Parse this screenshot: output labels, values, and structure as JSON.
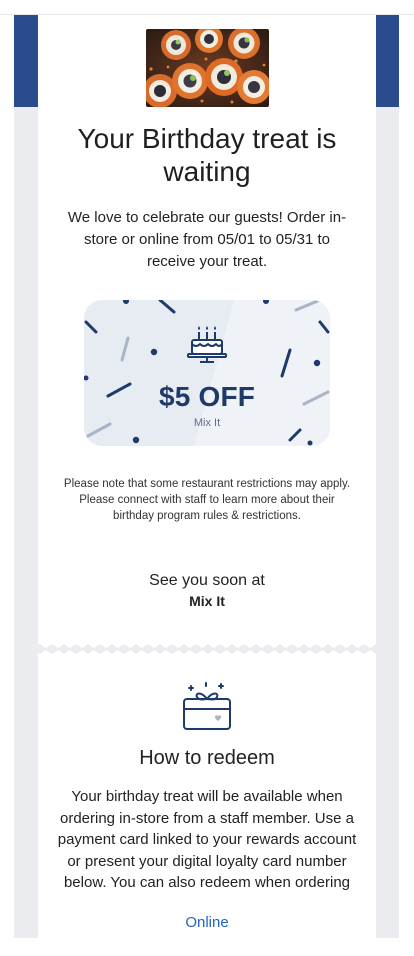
{
  "header": {
    "hero_image": "sushi-rolls-photo"
  },
  "main": {
    "title": "Your Birthday treat is waiting",
    "subtitle": "We love to celebrate our guests! Order in-store or online from 05/01 to 05/31 to receive your treat.",
    "coupon": {
      "icon": "birthday-cake-icon",
      "amount": "$5 OFF",
      "restaurant": "Mix It"
    },
    "note": "Please note that some restaurant restrictions may apply. Please connect with staff to learn more about their birthday program rules & restrictions.",
    "see_soon": "See you soon at",
    "restaurant_name": "Mix It"
  },
  "redeem": {
    "icon": "gift-card-icon",
    "title": "How to redeem",
    "body": "Your birthday treat will be available when ordering in-store from a staff member. Use a payment card linked to your rewards account or present your digital loyalty card number below. You can also redeem when ordering",
    "link_label": "Online"
  },
  "colors": {
    "brand_blue": "#2b4c8c",
    "dark_navy": "#1e3a6b",
    "link_blue": "#1f63c6",
    "page_gray": "#ebecef"
  }
}
